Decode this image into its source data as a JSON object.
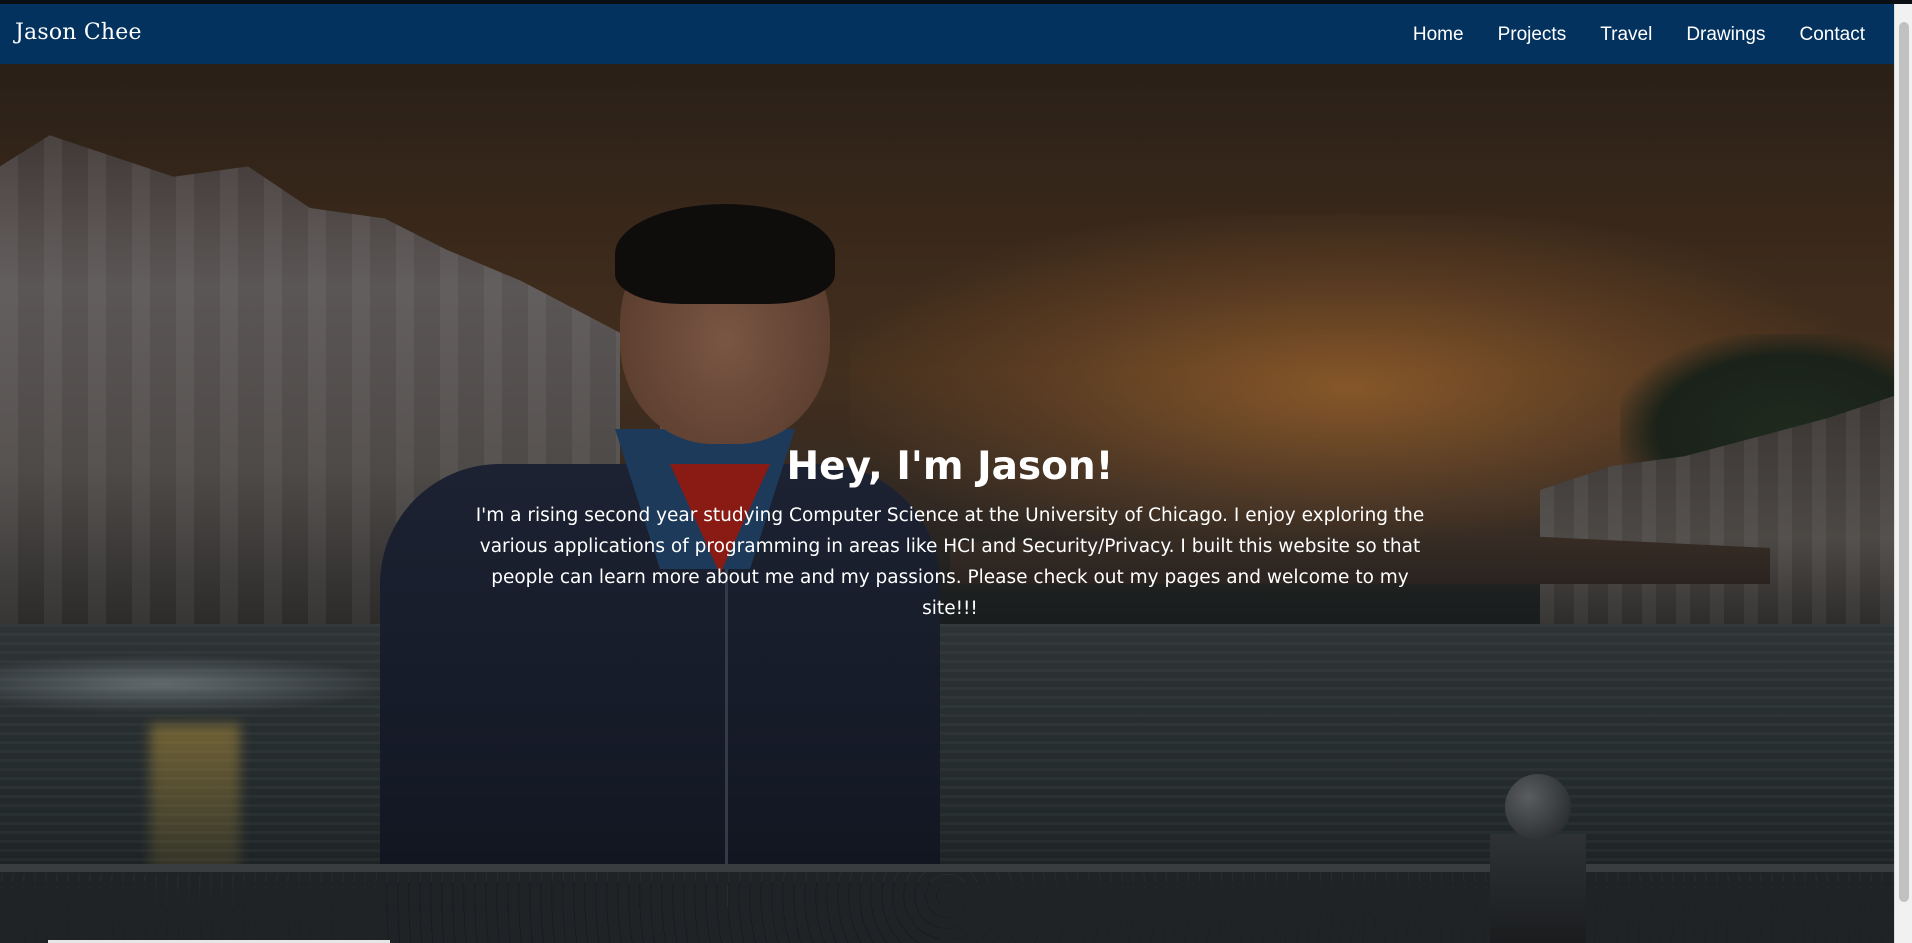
{
  "navbar": {
    "brand": "Jason Chee",
    "links": [
      {
        "label": "Home"
      },
      {
        "label": "Projects"
      },
      {
        "label": "Travel"
      },
      {
        "label": "Drawings"
      },
      {
        "label": "Contact"
      }
    ],
    "background_color": "#03325e"
  },
  "hero": {
    "title": "Hey, I'm Jason!",
    "text": "I'm a rising second year studying Computer Science at the University of Chicago. I enjoy exploring the various applications of programming in areas like HCI and Security/Privacy. I built this website so that people can learn more about me and my passions. Please check out my pages and welcome to my site!!!"
  }
}
